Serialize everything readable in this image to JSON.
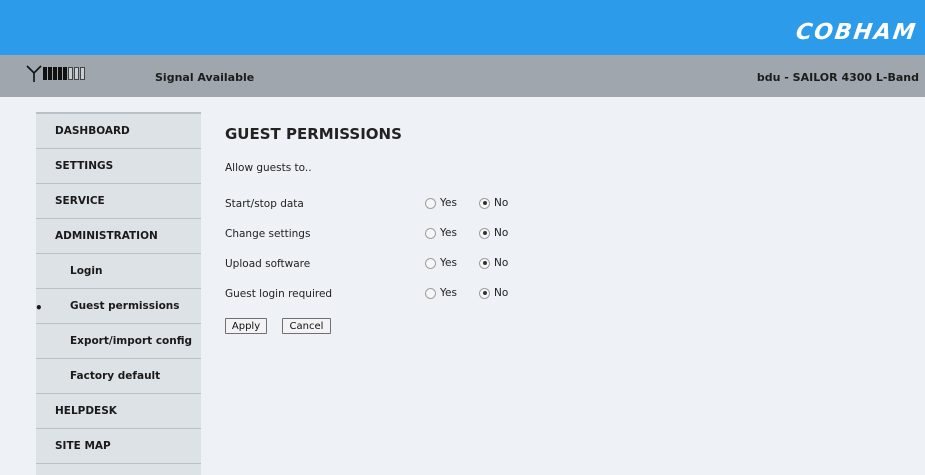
{
  "header": {
    "logo_text": "COBHAM",
    "brand_color": "#2c9bea"
  },
  "status": {
    "signal_text": "Signal Available",
    "signal_bars_on": 5,
    "signal_bars_total": 8,
    "device_text": "bdu - SAILOR 4300 L-Band"
  },
  "sidebar": {
    "items": [
      {
        "label": "DASHBOARD",
        "sub": false,
        "active": false
      },
      {
        "label": "SETTINGS",
        "sub": false,
        "active": false
      },
      {
        "label": "SERVICE",
        "sub": false,
        "active": false
      },
      {
        "label": "ADMINISTRATION",
        "sub": false,
        "active": false
      },
      {
        "label": "Login",
        "sub": true,
        "active": false
      },
      {
        "label": "Guest permissions",
        "sub": true,
        "active": true
      },
      {
        "label": "Export/import config",
        "sub": true,
        "active": false
      },
      {
        "label": "Factory default",
        "sub": true,
        "active": false
      },
      {
        "label": "HELPDESK",
        "sub": false,
        "active": false
      },
      {
        "label": "SITE MAP",
        "sub": false,
        "active": false
      }
    ]
  },
  "main": {
    "title": "GUEST PERMISSIONS",
    "intro": "Allow guests to..",
    "yes_label": "Yes",
    "no_label": "No",
    "rows": [
      {
        "label": "Start/stop data",
        "value": "No"
      },
      {
        "label": "Change settings",
        "value": "No"
      },
      {
        "label": "Upload software",
        "value": "No"
      },
      {
        "label": "Guest login required",
        "value": "No"
      }
    ],
    "apply_label": "Apply",
    "cancel_label": "Cancel"
  }
}
